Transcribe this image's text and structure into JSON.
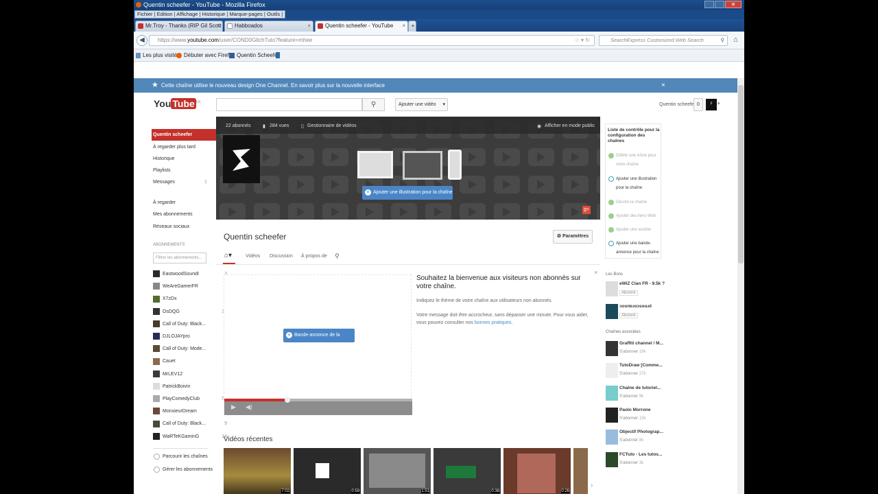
{
  "browser": {
    "title": "Quentin scheefer - YouTube - Mozilla Firefox",
    "menu": [
      "Fichier",
      "Edition",
      "Affichage",
      "Historique",
      "Marque-pages",
      "Outils"
    ],
    "tabs": [
      {
        "label": "Mr.Troy - Thanks (RIP Gil Scott Heron..."
      },
      {
        "label": "Habboados"
      },
      {
        "label": "Quentin scheefer - YouTube"
      }
    ],
    "new_tab": "+",
    "url_prefix": "https://www.",
    "url_domain": "youtube.com",
    "url_path": "/user/COND0GltchTuto?feature=mhee",
    "search_placeholder": "SearchExpress Customized Web Search",
    "bookmarks": [
      {
        "label": "Les plus visités"
      },
      {
        "label": "Débuter avec Firefox"
      },
      {
        "label": "Quentin Scheefer"
      }
    ]
  },
  "banner": {
    "text": "Cette chaîne utilise le nouveau design One Channel. En savoir plus sur la nouvelle interface",
    "close": "×"
  },
  "header": {
    "logo": "You",
    "logo2": "Tube",
    "region": "FR",
    "upload": "Ajouter une vidéo",
    "user": "Quentin scheefer",
    "notif": "0"
  },
  "sidebar": {
    "nav": [
      {
        "label": "Quentin scheefer"
      },
      {
        "label": "À regarder plus tard"
      },
      {
        "label": "Historique"
      },
      {
        "label": "Playlists"
      },
      {
        "label": "Messages",
        "count": "1"
      }
    ],
    "nav2": [
      {
        "label": "À regarder"
      },
      {
        "label": "Mes abonnements"
      },
      {
        "label": "Réseaux sociaux"
      }
    ],
    "subs_heading": "ABONNEMENTS",
    "filter_placeholder": "Filtrer les abonnements...",
    "subs": [
      {
        "label": "EastwoodSoundI",
        "count": "3"
      },
      {
        "label": "WeAreGamerFR",
        "count": "1"
      },
      {
        "label": "X7zDx",
        "count": "2"
      },
      {
        "label": "OsDQG",
        "count": "36"
      },
      {
        "label": "Call of Duty: Black...",
        "count": "7"
      },
      {
        "label": "DJLOJAYpro",
        "count": "4"
      },
      {
        "label": "Call of Duty: Mode...",
        "count": "2"
      },
      {
        "label": "Cauet",
        "count": "2"
      },
      {
        "label": "MrLEV12",
        "count": "8"
      },
      {
        "label": "PatrickBoivin",
        "count": ""
      },
      {
        "label": "PlayComedyClub",
        "count": "53"
      },
      {
        "label": "MonsieurDream",
        "count": "2"
      },
      {
        "label": "Call of Duty: Black...",
        "count": "9"
      },
      {
        "label": "WaRTeKGaminG",
        "count": "14"
      }
    ],
    "browse": "Parcourir les chaînes",
    "manage": "Gérer les abonnements"
  },
  "channel": {
    "subscribers": "22 abonnés",
    "views": "284 vues",
    "video_manager": "Gestionnaire de vidéos",
    "public_view": "Afficher en mode public",
    "add_art": "Ajouter une illustration pour la chaîne",
    "name": "Quentin scheefer",
    "settings": "Paramètres",
    "tabs": [
      "Vidéos",
      "Discussion",
      "À propos de"
    ],
    "trailer_btn": "Bande-annonce de la chaîne",
    "welcome_title": "Souhaitez la bienvenue aux visiteurs non abonnés sur votre chaîne.",
    "welcome_p1": "Indiquez le thème de votre chaîne aux utilisateurs non abonnés.",
    "welcome_p2": "Votre message doit être accrocheur, sans dépasser une minute. Pour vous aider, vous pouvez consulter nos",
    "welcome_link": "bonnes pratiques",
    "recent": "Vidéos récentes",
    "thumb_times": [
      "7:02",
      "0:59",
      "1:51",
      "0:38",
      "0:26"
    ]
  },
  "checklist": {
    "title": "Liste de contrôle pour la configuration des chaînes",
    "items": [
      {
        "label": "Définir une icône pour votre chaîne",
        "done": true
      },
      {
        "label": "Ajouter une illustration pour la chaîne",
        "done": false
      },
      {
        "label": "Décrire la chaîne",
        "done": true
      },
      {
        "label": "Ajouter des liens Web",
        "done": true
      },
      {
        "label": "Ajouter une section",
        "done": true
      },
      {
        "label": "Ajouter une bande-annonce pour la chaîne",
        "done": false
      }
    ]
  },
  "friends": {
    "heading": "Les Bons",
    "items": [
      {
        "name": "eWiZ Clan FR - 9.5k ?",
        "sub": "Abonné"
      },
      {
        "name": "ɔosnɐɹoɔsouɹıʇ",
        "sub": "Abonné"
      }
    ]
  },
  "related": {
    "heading": "Chaînes associées",
    "items": [
      {
        "name": "Graffiti channel / M...",
        "sub": "S'abonner",
        "count": "19k"
      },
      {
        "name": "TutoDraw [Comme...",
        "sub": "S'abonner",
        "count": "27k"
      },
      {
        "name": "Chaîne de tutoriel...",
        "sub": "S'abonner",
        "count": "9k"
      },
      {
        "name": "Paolo Morrone",
        "sub": "S'abonner",
        "count": "13k"
      },
      {
        "name": "Objectif Photograp...",
        "sub": "S'abonner",
        "count": "8k"
      },
      {
        "name": "FCTuto - Les tutos...",
        "sub": "S'abonner",
        "count": "3k"
      }
    ]
  },
  "colors": {
    "accent": "#c4302b",
    "banner": "#5287b9",
    "button": "#4a86c7"
  }
}
